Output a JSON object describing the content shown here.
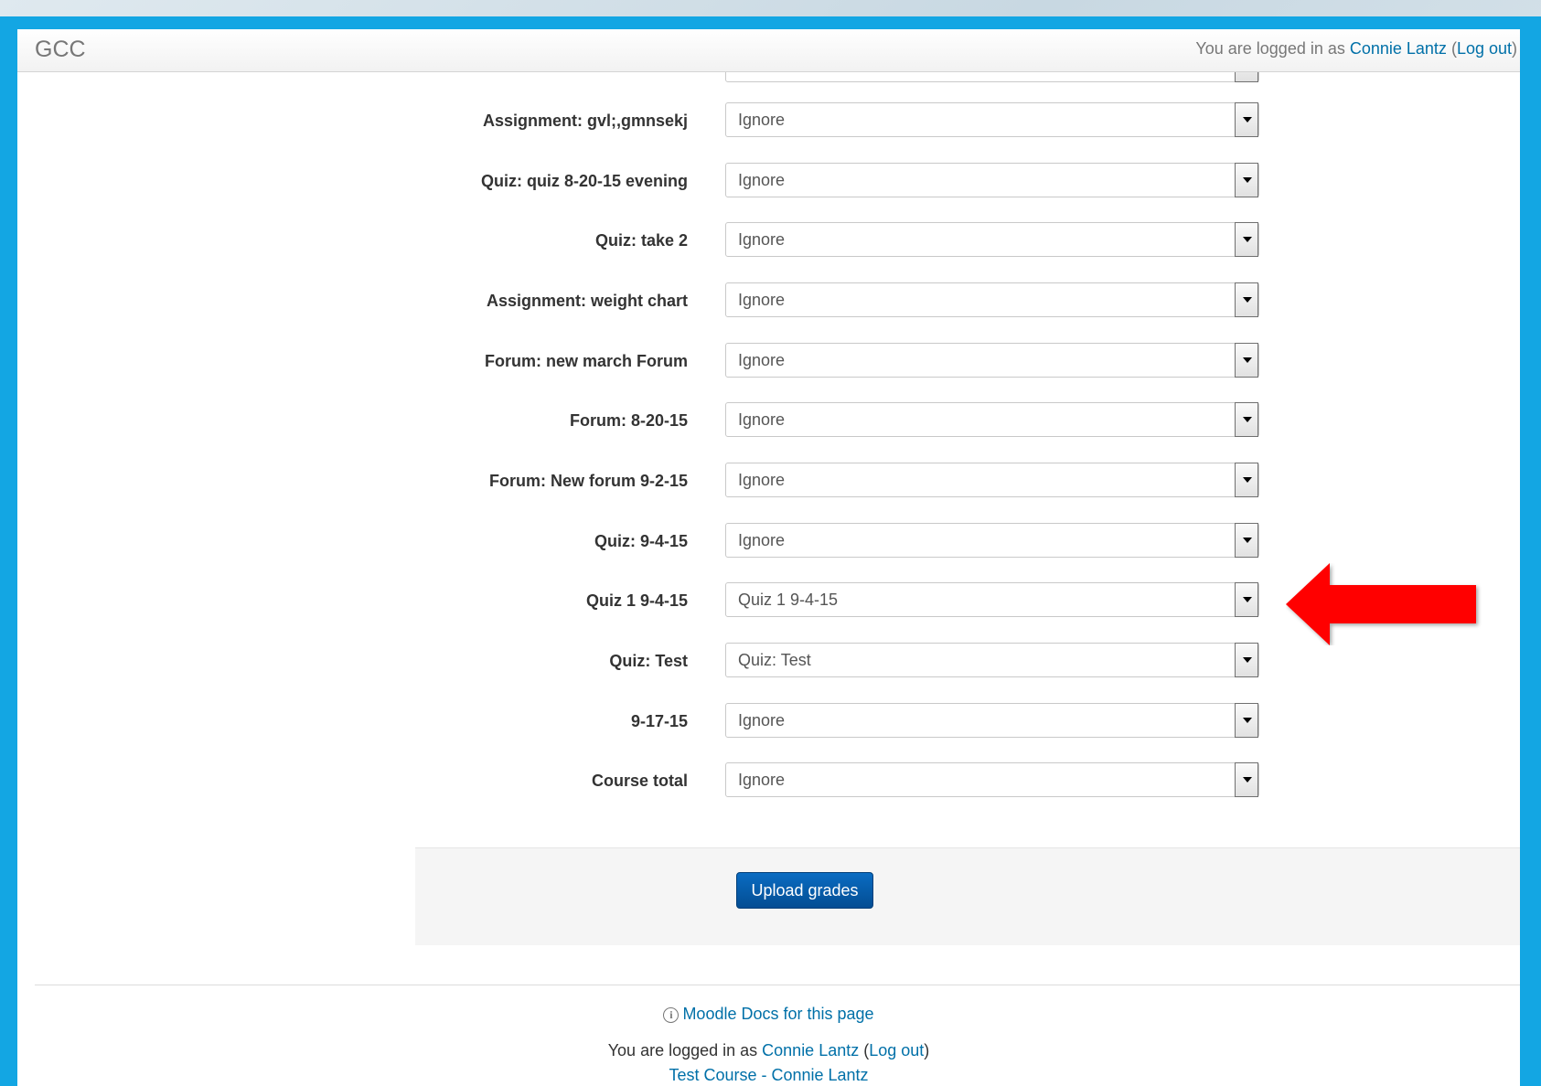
{
  "navbar": {
    "brand": "GCC",
    "login_prefix": "You are logged in as ",
    "user_name": "Connie Lantz",
    "open_paren": " (",
    "logout_label": "Log out",
    "close_paren": ")"
  },
  "mapping_rows": [
    {
      "label": "Assignment: gvl;,gmnsekj",
      "value": "Ignore"
    },
    {
      "label": "Quiz: quiz 8-20-15 evening",
      "value": "Ignore"
    },
    {
      "label": "Quiz: take 2",
      "value": "Ignore"
    },
    {
      "label": "Assignment: weight chart",
      "value": "Ignore"
    },
    {
      "label": "Forum: new march Forum",
      "value": "Ignore"
    },
    {
      "label": "Forum: 8-20-15",
      "value": "Ignore"
    },
    {
      "label": "Forum: New forum 9-2-15",
      "value": "Ignore"
    },
    {
      "label": "Quiz: 9-4-15",
      "value": "Ignore"
    },
    {
      "label": "Quiz 1 9-4-15",
      "value": "Quiz 1 9-4-15"
    },
    {
      "label": "Quiz: Test",
      "value": "Quiz: Test"
    },
    {
      "label": "9-17-15",
      "value": "Ignore"
    },
    {
      "label": "Course total",
      "value": "Ignore"
    }
  ],
  "actions": {
    "upload_label": "Upload grades"
  },
  "footer": {
    "docs_label": "Moodle Docs for this page",
    "login_prefix": "You are logged in as ",
    "user_name": "Connie Lantz",
    "open_paren": " (",
    "logout_label": "Log out",
    "close_paren": ")",
    "course_link": "Test Course - Connie Lantz"
  },
  "colors": {
    "frame": "#13a6e3",
    "link": "#0070a8",
    "button": "#0a5fb4",
    "arrow": "#ff0000"
  }
}
